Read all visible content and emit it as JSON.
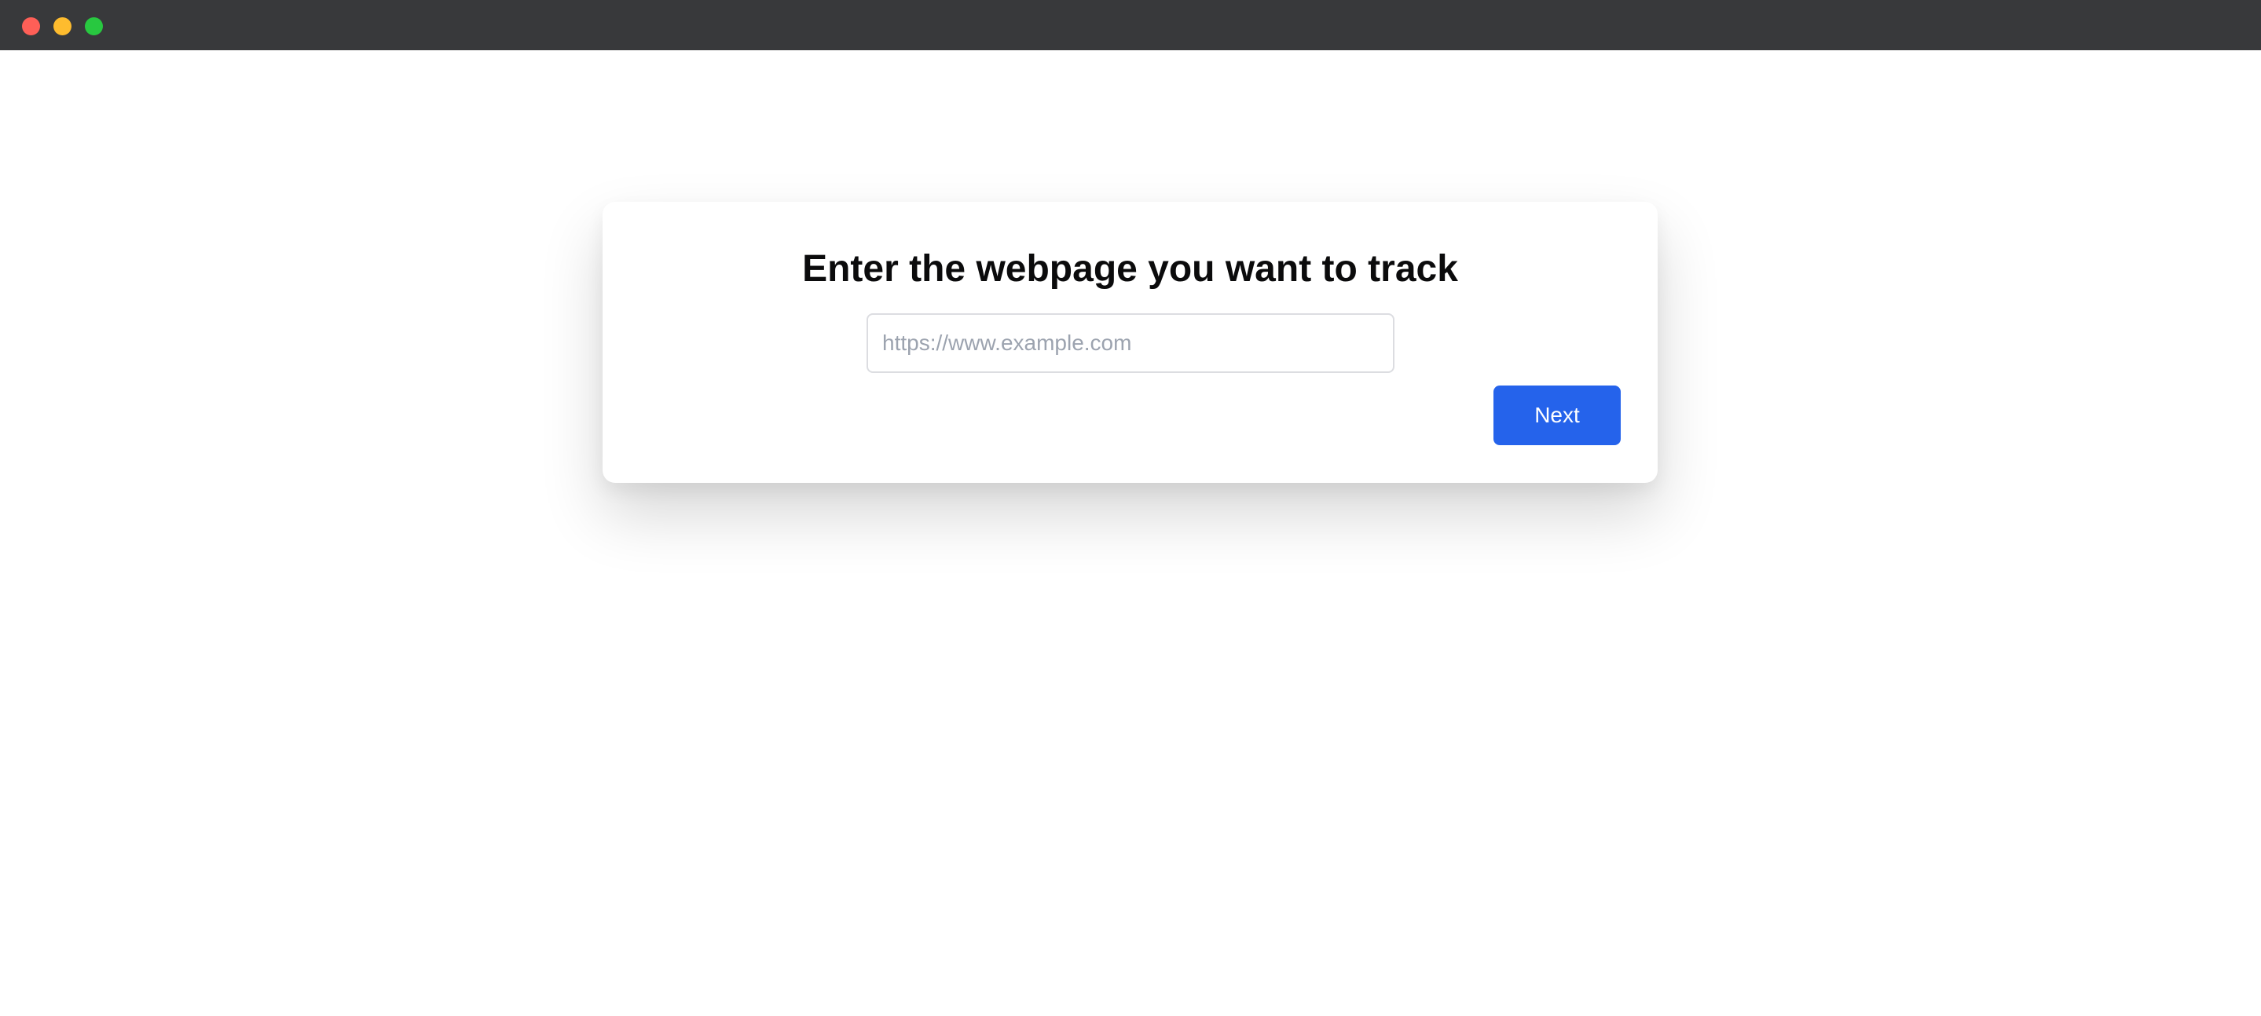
{
  "window": {
    "controls": {
      "close": {
        "icon": "close-icon",
        "color": "#fe5f57"
      },
      "minimize": {
        "icon": "minimize-icon",
        "color": "#febc2e"
      },
      "maximize": {
        "icon": "maximize-icon",
        "color": "#28c840"
      }
    },
    "titlebar_color": "#38393b"
  },
  "card": {
    "title": "Enter the webpage you want to track",
    "url_input": {
      "value": "",
      "placeholder": "https://www.example.com"
    },
    "next_label": "Next"
  },
  "colors": {
    "accent": "#2563eb",
    "background": "#ffffff"
  }
}
